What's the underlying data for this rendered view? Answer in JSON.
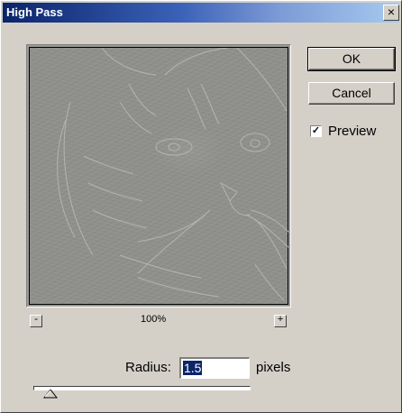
{
  "dialog": {
    "title": "High Pass",
    "close_glyph": "×"
  },
  "buttons": {
    "ok_label": "OK",
    "cancel_label": "Cancel"
  },
  "preview": {
    "label": "Preview",
    "checked": true,
    "check_glyph": "✓"
  },
  "zoom": {
    "out_glyph": "-",
    "in_glyph": "+",
    "level": "100%"
  },
  "radius": {
    "label": "Radius:",
    "value": "1.5",
    "units": "pixels",
    "slider_fraction": 0.08
  },
  "icons": {
    "close": "close-icon",
    "zoom_out": "minus-icon",
    "zoom_in": "plus-icon",
    "checkbox": "checkmark-icon",
    "slider": "triangle-thumb-icon"
  },
  "colors": {
    "face": "#d4d0c8",
    "title_active": "#0a246a",
    "selection": "#0a246a"
  }
}
